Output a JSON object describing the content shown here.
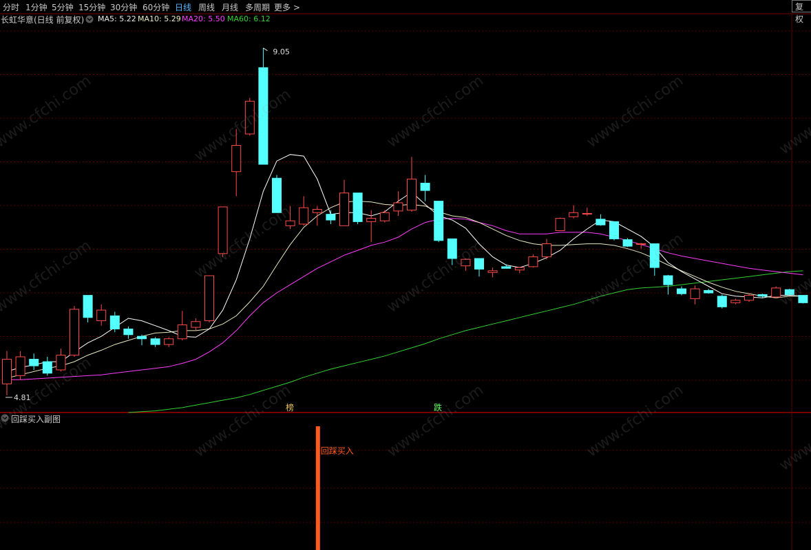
{
  "toolbar": {
    "periods": [
      {
        "label": "分时",
        "active": false
      },
      {
        "label": "1分钟",
        "active": false
      },
      {
        "label": "5分钟",
        "active": false
      },
      {
        "label": "15分钟",
        "active": false
      },
      {
        "label": "30分钟",
        "active": false
      },
      {
        "label": "60分钟",
        "active": false
      },
      {
        "label": "日线",
        "active": true
      },
      {
        "label": "周线",
        "active": false
      },
      {
        "label": "月线",
        "active": false
      },
      {
        "label": "多周期",
        "active": false
      },
      {
        "label": "更多 >",
        "active": false
      }
    ],
    "fuquan_label": "复权"
  },
  "legend": {
    "title": "长虹华意(日线 前复权)",
    "ma5": "MA5: 5.22",
    "ma10": "MA10: 5.29",
    "ma20": "MA20: 5.50",
    "ma60": "MA60: 6.12"
  },
  "colors": {
    "up": "#ff4b4b",
    "down": "#54ffff",
    "ma5": "#ffffff",
    "ma10": "#e8e8c0",
    "ma20": "#ff3cff",
    "ma60": "#32d232",
    "grid": "#5a0000",
    "signal": "#ff5a1e"
  },
  "annotations": {
    "high_label": "9.05",
    "low_label": "4.81",
    "marker_bang": "榜",
    "marker_die": "跌"
  },
  "subchart": {
    "title": "回踩买入副图",
    "signal_label": "回踩买入"
  },
  "watermark": "www.cfchi.com",
  "chart_data": {
    "type": "candlestick",
    "symbol": "长虹华意",
    "candles": [
      {
        "o": 4.95,
        "c": 5.25,
        "h": 5.35,
        "l": 4.81
      },
      {
        "o": 5.05,
        "c": 5.28,
        "h": 5.35,
        "l": 5.0
      },
      {
        "o": 5.25,
        "c": 5.17,
        "h": 5.32,
        "l": 5.12
      },
      {
        "o": 5.22,
        "c": 5.08,
        "h": 5.28,
        "l": 5.05
      },
      {
        "o": 5.12,
        "c": 5.3,
        "h": 5.38,
        "l": 5.1
      },
      {
        "o": 5.3,
        "c": 5.86,
        "h": 5.9,
        "l": 5.28
      },
      {
        "o": 6.03,
        "c": 5.76,
        "h": 6.03,
        "l": 5.7
      },
      {
        "o": 5.72,
        "c": 5.85,
        "h": 5.92,
        "l": 5.66
      },
      {
        "o": 5.78,
        "c": 5.62,
        "h": 5.83,
        "l": 5.58
      },
      {
        "o": 5.62,
        "c": 5.55,
        "h": 5.65,
        "l": 5.5
      },
      {
        "o": 5.53,
        "c": 5.5,
        "h": 5.55,
        "l": 5.42
      },
      {
        "o": 5.5,
        "c": 5.43,
        "h": 5.52,
        "l": 5.4
      },
      {
        "o": 5.43,
        "c": 5.5,
        "h": 5.52,
        "l": 5.4
      },
      {
        "o": 5.5,
        "c": 5.67,
        "h": 5.84,
        "l": 5.48
      },
      {
        "o": 5.64,
        "c": 5.71,
        "h": 5.75,
        "l": 5.6
      },
      {
        "o": 5.72,
        "c": 6.27,
        "h": 6.27,
        "l": 5.7
      },
      {
        "o": 6.54,
        "c": 7.11,
        "h": 7.11,
        "l": 6.5
      },
      {
        "o": 7.54,
        "c": 7.86,
        "h": 8.06,
        "l": 7.24
      },
      {
        "o": 8.0,
        "c": 8.4,
        "h": 8.44,
        "l": 7.98
      },
      {
        "o": 8.81,
        "c": 7.63,
        "h": 9.05,
        "l": 7.63
      },
      {
        "o": 7.46,
        "c": 7.04,
        "h": 7.5,
        "l": 7.04
      },
      {
        "o": 6.88,
        "c": 6.94,
        "h": 7.12,
        "l": 6.84
      },
      {
        "o": 6.9,
        "c": 7.1,
        "h": 7.24,
        "l": 6.88
      },
      {
        "o": 7.04,
        "c": 7.08,
        "h": 7.12,
        "l": 6.88
      },
      {
        "o": 7.02,
        "c": 6.95,
        "h": 7.07,
        "l": 6.9
      },
      {
        "o": 6.88,
        "c": 7.28,
        "h": 7.44,
        "l": 6.88
      },
      {
        "o": 7.28,
        "c": 6.93,
        "h": 7.28,
        "l": 6.9
      },
      {
        "o": 6.93,
        "c": 6.97,
        "h": 7.07,
        "l": 6.68
      },
      {
        "o": 6.94,
        "c": 7.04,
        "h": 7.07,
        "l": 6.92
      },
      {
        "o": 7.06,
        "c": 7.16,
        "h": 7.3,
        "l": 7.0
      },
      {
        "o": 7.07,
        "c": 7.45,
        "h": 7.72,
        "l": 7.05
      },
      {
        "o": 7.4,
        "c": 7.31,
        "h": 7.5,
        "l": 7.18
      },
      {
        "o": 7.18,
        "c": 6.7,
        "h": 7.18,
        "l": 6.68
      },
      {
        "o": 6.72,
        "c": 6.48,
        "h": 6.72,
        "l": 6.4
      },
      {
        "o": 6.39,
        "c": 6.47,
        "h": 6.48,
        "l": 6.33
      },
      {
        "o": 6.48,
        "c": 6.35,
        "h": 6.48,
        "l": 6.26
      },
      {
        "o": 6.31,
        "c": 6.33,
        "h": 6.37,
        "l": 6.25
      },
      {
        "o": 6.38,
        "c": 6.36,
        "h": 6.41,
        "l": 6.36
      },
      {
        "o": 6.34,
        "c": 6.37,
        "h": 6.38,
        "l": 6.3
      },
      {
        "o": 6.38,
        "c": 6.5,
        "h": 6.53,
        "l": 6.37
      },
      {
        "o": 6.5,
        "c": 6.66,
        "h": 6.72,
        "l": 6.47
      },
      {
        "o": 6.82,
        "c": 6.97,
        "h": 6.98,
        "l": 6.82
      },
      {
        "o": 6.99,
        "c": 7.04,
        "h": 7.13,
        "l": 6.97
      },
      {
        "o": 7.03,
        "c": 7.03,
        "h": 7.1,
        "l": 7.0
      },
      {
        "o": 6.96,
        "c": 6.89,
        "h": 7.02,
        "l": 6.88
      },
      {
        "o": 6.93,
        "c": 6.72,
        "h": 6.93,
        "l": 6.7
      },
      {
        "o": 6.71,
        "c": 6.63,
        "h": 6.73,
        "l": 6.62
      },
      {
        "o": 6.66,
        "c": 6.66,
        "h": 6.67,
        "l": 6.6
      },
      {
        "o": 6.66,
        "c": 6.37,
        "h": 6.66,
        "l": 6.27
      },
      {
        "o": 6.27,
        "c": 6.16,
        "h": 6.28,
        "l": 6.04
      },
      {
        "o": 6.11,
        "c": 6.05,
        "h": 6.14,
        "l": 6.03
      },
      {
        "o": 5.99,
        "c": 6.11,
        "h": 6.15,
        "l": 5.92
      },
      {
        "o": 6.09,
        "c": 6.06,
        "h": 6.11,
        "l": 6.05
      },
      {
        "o": 6.02,
        "c": 5.89,
        "h": 6.04,
        "l": 5.87
      },
      {
        "o": 5.94,
        "c": 5.97,
        "h": 5.99,
        "l": 5.92
      },
      {
        "o": 5.97,
        "c": 6.03,
        "h": 6.05,
        "l": 5.95
      },
      {
        "o": 6.04,
        "c": 6.02,
        "h": 6.05,
        "l": 6.0
      },
      {
        "o": 6.01,
        "c": 6.12,
        "h": 6.14,
        "l": 6.0
      },
      {
        "o": 6.1,
        "c": 6.04,
        "h": 6.11,
        "l": 6.03
      },
      {
        "o": 6.03,
        "c": 5.94,
        "h": 6.03,
        "l": 5.93
      }
    ],
    "ma5": [
      5.1,
      5.15,
      5.18,
      5.22,
      5.22,
      5.34,
      5.45,
      5.53,
      5.64,
      5.75,
      5.72,
      5.66,
      5.6,
      5.53,
      5.52,
      5.62,
      5.85,
      6.22,
      6.72,
      7.3,
      7.67,
      7.75,
      7.73,
      7.45,
      7.02,
      7.04,
      7.04,
      7.0,
      7.05,
      7.18,
      7.29,
      7.14,
      7.0,
      6.95,
      6.85,
      6.66,
      6.5,
      6.4,
      6.37,
      6.42,
      6.49,
      6.58,
      6.72,
      6.84,
      6.95,
      6.93,
      6.84,
      6.75,
      6.62,
      6.43,
      6.32,
      6.23,
      6.14,
      6.05,
      6.02,
      6.01,
      6.0,
      6.03,
      6.03,
      6.02
    ],
    "ma10": [
      5.02,
      5.06,
      5.1,
      5.14,
      5.17,
      5.22,
      5.3,
      5.36,
      5.43,
      5.48,
      5.53,
      5.57,
      5.58,
      5.6,
      5.6,
      5.62,
      5.68,
      5.78,
      5.95,
      6.14,
      6.4,
      6.65,
      6.86,
      7.0,
      7.1,
      7.17,
      7.18,
      7.17,
      7.14,
      7.13,
      7.14,
      7.12,
      7.05,
      7.0,
      6.98,
      6.92,
      6.84,
      6.76,
      6.7,
      6.66,
      6.64,
      6.64,
      6.65,
      6.66,
      6.66,
      6.64,
      6.6,
      6.55,
      6.48,
      6.4,
      6.33,
      6.26,
      6.19,
      6.13,
      6.08,
      6.05,
      6.02,
      6.0,
      6.02,
      6.02
    ],
    "ma20": [
      5.0,
      5.0,
      5.01,
      5.02,
      5.03,
      5.04,
      5.05,
      5.06,
      5.08,
      5.1,
      5.12,
      5.14,
      5.16,
      5.2,
      5.25,
      5.34,
      5.45,
      5.6,
      5.78,
      5.94,
      6.06,
      6.16,
      6.26,
      6.36,
      6.44,
      6.52,
      6.58,
      6.64,
      6.68,
      6.74,
      6.84,
      6.92,
      6.96,
      6.97,
      6.96,
      6.92,
      6.88,
      6.82,
      6.78,
      6.78,
      6.78,
      6.8,
      6.8,
      6.8,
      6.78,
      6.74,
      6.7,
      6.65,
      6.6,
      6.55,
      6.51,
      6.48,
      6.45,
      6.42,
      6.39,
      6.36,
      6.34,
      6.32,
      6.3,
      6.28
    ],
    "ma60": {
      "start_index": 9,
      "values": [
        4.6,
        4.61,
        4.62,
        4.64,
        4.66,
        4.69,
        4.72,
        4.75,
        4.78,
        4.82,
        4.87,
        4.92,
        4.97,
        5.03,
        5.08,
        5.13,
        5.17,
        5.21,
        5.25,
        5.29,
        5.34,
        5.39,
        5.44,
        5.5,
        5.55,
        5.6,
        5.64,
        5.68,
        5.72,
        5.76,
        5.8,
        5.84,
        5.88,
        5.92,
        5.97,
        6.02,
        6.06,
        6.1,
        6.12,
        6.13,
        6.14,
        6.16,
        6.18,
        6.2,
        6.22,
        6.24,
        6.26,
        6.28,
        6.3,
        6.32,
        6.33
      ]
    },
    "signal_index": 23,
    "y_range": [
      4.6,
      9.3
    ]
  }
}
